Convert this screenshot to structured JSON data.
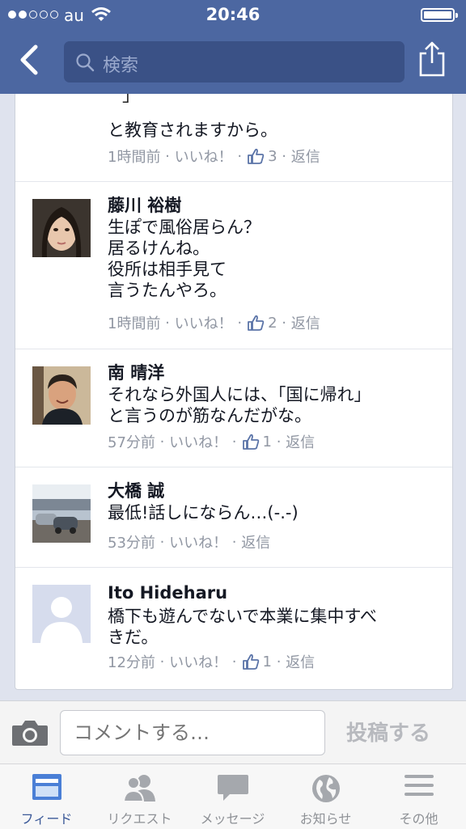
{
  "status_bar": {
    "carrier": "au",
    "time": "20:46"
  },
  "nav": {
    "search_placeholder": "検索"
  },
  "truncated_line": "」",
  "comments": [
    {
      "name": "",
      "body": "と教育されますから。",
      "time": "1時間前",
      "like": "いいね！",
      "likes": "3",
      "reply": "返信"
    },
    {
      "name": "藤川 裕樹",
      "body": "生ぽで風俗居らん？\n居るけんね。\n役所は相手見て\n言うたんやろ。",
      "time": "1時間前",
      "like": "いいね！",
      "likes": "2",
      "reply": "返信"
    },
    {
      "name": "南 晴洋",
      "body": "それなら外国人には、「国に帰れ」\nと言うのが筋なんだがな。",
      "time": "57分前",
      "like": "いいね！",
      "likes": "1",
      "reply": "返信"
    },
    {
      "name": "大橋 誠",
      "body": "最低!話しにならん…(-.-)",
      "time": "53分前",
      "like": "いいね！",
      "likes": "",
      "reply": "返信"
    },
    {
      "name": "Ito  Hideharu",
      "body": "橋下も遊んでないで本業に集中すべ\nきだ。",
      "time": "12分前",
      "like": "いいね！",
      "likes": "1",
      "reply": "返信"
    }
  ],
  "composer": {
    "placeholder": "コメントする…",
    "post_label": "投稿する"
  },
  "tabs": [
    {
      "label": "フィード",
      "icon": "feed-icon",
      "active": true
    },
    {
      "label": "リクエスト",
      "icon": "friend-requests-icon",
      "active": false
    },
    {
      "label": "メッセージ",
      "icon": "messages-icon",
      "active": false
    },
    {
      "label": "お知らせ",
      "icon": "globe-icon",
      "active": false
    },
    {
      "label": "その他",
      "icon": "menu-icon",
      "active": false
    }
  ],
  "colors": {
    "nav_bar": "#4c67a1",
    "search_field": "#3a5186",
    "meta_text": "#9197a3",
    "active_tab": "#3b5998"
  }
}
